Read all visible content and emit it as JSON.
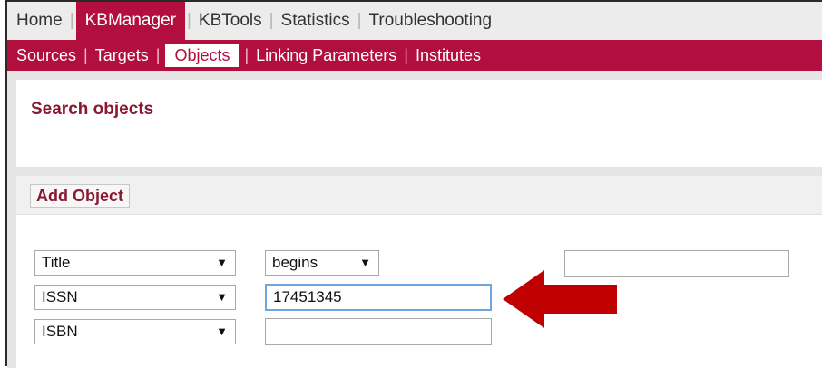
{
  "topnav": {
    "items": [
      {
        "label": "Home",
        "active": false
      },
      {
        "label": "KBManager",
        "active": true
      },
      {
        "label": "KBTools",
        "active": false
      },
      {
        "label": "Statistics",
        "active": false
      },
      {
        "label": "Troubleshooting",
        "active": false
      }
    ]
  },
  "subnav": {
    "items": [
      {
        "label": "Sources",
        "active": false
      },
      {
        "label": "Targets",
        "active": false
      },
      {
        "label": "Objects",
        "active": true
      },
      {
        "label": "Linking Parameters",
        "active": false
      },
      {
        "label": "Institutes",
        "active": false
      }
    ]
  },
  "search": {
    "title": "Search objects"
  },
  "actions": {
    "add_object_label": "Add Object"
  },
  "form": {
    "row1": {
      "field": "Title",
      "operator": "begins",
      "value": ""
    },
    "row2": {
      "field": "ISSN",
      "value": "17451345"
    },
    "row3": {
      "field": "ISBN",
      "value": ""
    }
  },
  "icons": {
    "dropdown": "dropdown-arrow-icon",
    "pointer": "red-arrow-icon"
  },
  "colors": {
    "brand": "#b30f3e",
    "title": "#8a1833",
    "focus": "#6ea6dd",
    "arrow": "#c00000"
  }
}
